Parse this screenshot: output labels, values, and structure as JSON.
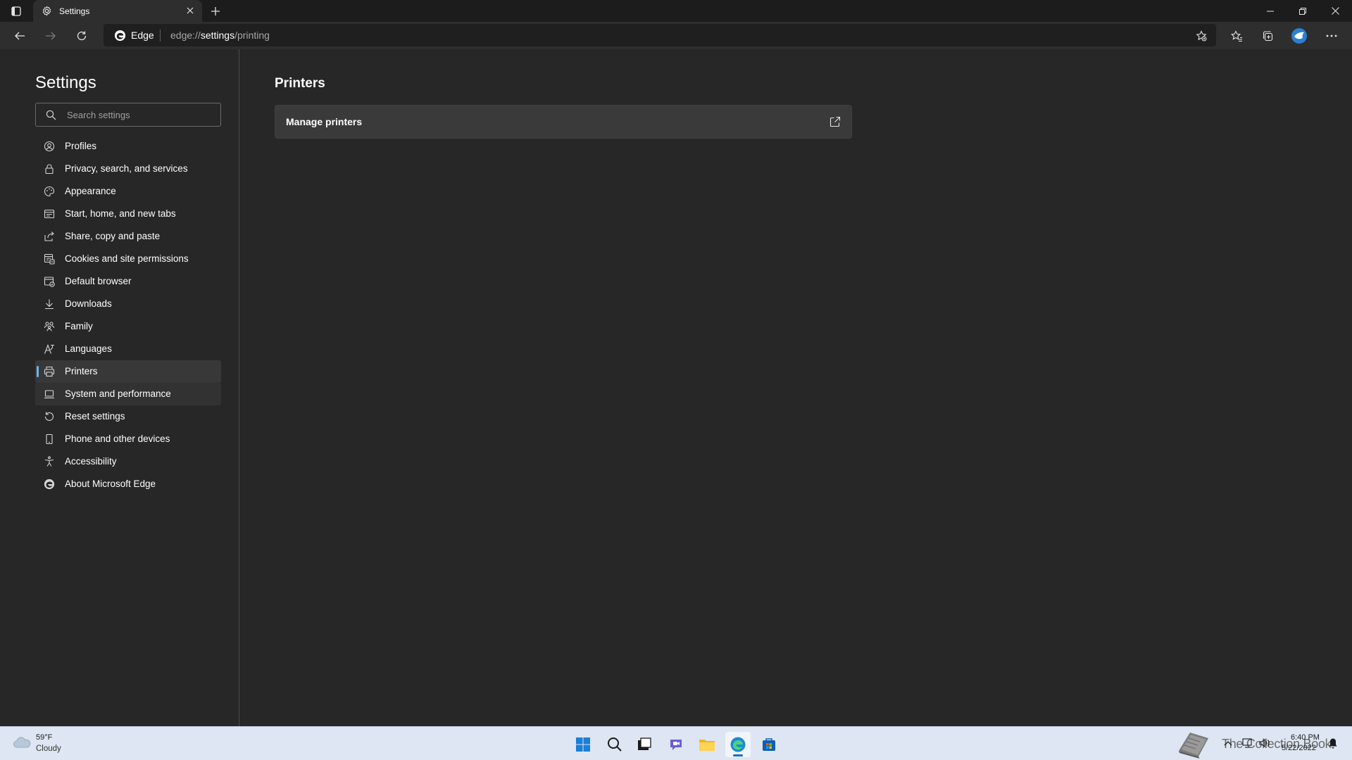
{
  "window": {
    "tab_title": "Settings",
    "tab_icon": "gear-icon"
  },
  "addressbar": {
    "site_label": "Edge",
    "url_prefix": "edge://",
    "url_highlight": "settings",
    "url_suffix": "/printing"
  },
  "sidebar": {
    "title": "Settings",
    "search_placeholder": "Search settings",
    "items": [
      {
        "label": "Profiles",
        "icon": "profile-icon"
      },
      {
        "label": "Privacy, search, and services",
        "icon": "lock-icon"
      },
      {
        "label": "Appearance",
        "icon": "palette-icon"
      },
      {
        "label": "Start, home, and new tabs",
        "icon": "home-tabs-icon"
      },
      {
        "label": "Share, copy and paste",
        "icon": "share-icon"
      },
      {
        "label": "Cookies and site permissions",
        "icon": "cookies-icon"
      },
      {
        "label": "Default browser",
        "icon": "browser-icon"
      },
      {
        "label": "Downloads",
        "icon": "download-icon"
      },
      {
        "label": "Family",
        "icon": "family-icon"
      },
      {
        "label": "Languages",
        "icon": "languages-icon"
      },
      {
        "label": "Printers",
        "icon": "printer-icon",
        "active": true
      },
      {
        "label": "System and performance",
        "icon": "laptop-icon"
      },
      {
        "label": "Reset settings",
        "icon": "reset-icon"
      },
      {
        "label": "Phone and other devices",
        "icon": "phone-icon"
      },
      {
        "label": "Accessibility",
        "icon": "accessibility-icon"
      },
      {
        "label": "About Microsoft Edge",
        "icon": "edge-icon"
      }
    ]
  },
  "main": {
    "title": "Printers",
    "card_label": "Manage printers"
  },
  "taskbar": {
    "weather_temp": "59°F",
    "weather_desc": "Cloudy",
    "overlay_text": "The Collection Book",
    "time": "6:40 PM",
    "date": "5/22/2022"
  },
  "colors": {
    "accent": "#6cb4ee",
    "background": "#272727",
    "card": "#3a3a3a",
    "taskbar": "#dde6f2"
  }
}
